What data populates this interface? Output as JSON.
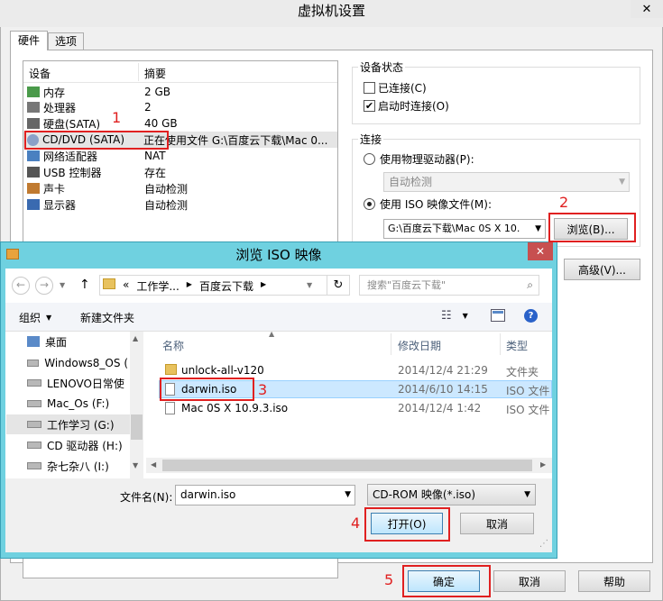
{
  "vm_dialog": {
    "title": "虚拟机设置",
    "close_icon": "close-icon",
    "tabs": [
      "硬件",
      "选项"
    ],
    "device_list": {
      "headers": [
        "设备",
        "摘要"
      ],
      "rows": [
        {
          "icon": "memory-icon",
          "name": "内存",
          "summary": "2 GB"
        },
        {
          "icon": "cpu-icon",
          "name": "处理器",
          "summary": "2"
        },
        {
          "icon": "disk-icon",
          "name": "硬盘(SATA)",
          "summary": "40 GB"
        },
        {
          "icon": "cd-icon",
          "name": "CD/DVD (SATA)",
          "summary": "正在使用文件 G:\\百度云下载\\Mac 0..."
        },
        {
          "icon": "network-icon",
          "name": "网络适配器",
          "summary": "NAT"
        },
        {
          "icon": "usb-icon",
          "name": "USB 控制器",
          "summary": "存在"
        },
        {
          "icon": "sound-icon",
          "name": "声卡",
          "summary": "自动检测"
        },
        {
          "icon": "display-icon",
          "name": "显示器",
          "summary": "自动检测"
        }
      ]
    },
    "device_status": {
      "title": "设备状态",
      "connected": "已连接(C)",
      "connect_on_start": "启动时连接(O)"
    },
    "connection": {
      "title": "连接",
      "physical_drive": "使用物理驱动器(P):",
      "auto_detect": "自动检测",
      "iso_file": "使用 ISO 映像文件(M):",
      "iso_path": "G:\\百度云下载\\Mac 0S X 10.",
      "browse": "浏览(B)..."
    },
    "advanced": "高级(V)...",
    "ok": "确定",
    "cancel": "取消",
    "help": "帮助"
  },
  "iso_dialog": {
    "title": "浏览 ISO 映像",
    "breadcrumb": [
      "«",
      "工作学...",
      "百度云下载"
    ],
    "search_placeholder": "搜索\"百度云下载\"",
    "organize": "组织",
    "new_folder": "新建文件夹",
    "nav": [
      {
        "icon": "folder-icon",
        "label": "桌面"
      },
      {
        "icon": "drive-icon",
        "label": "Windows8_OS ("
      },
      {
        "icon": "drive-icon",
        "label": "LENOVO日常使"
      },
      {
        "icon": "drive-icon",
        "label": "Mac_Os (F:)"
      },
      {
        "icon": "drive-icon",
        "label": "工作学习 (G:)"
      },
      {
        "icon": "cd-drive-icon",
        "label": "CD 驱动器 (H:)"
      },
      {
        "icon": "drive-icon",
        "label": "杂七杂八 (I:)"
      }
    ],
    "columns": [
      "名称",
      "修改日期",
      "类型"
    ],
    "files": [
      {
        "icon": "folder-icon",
        "name": "unlock-all-v120",
        "date": "2014/12/4 21:29",
        "type": "文件夹"
      },
      {
        "icon": "iso-file-icon",
        "name": "darwin.iso",
        "date": "2014/6/10 14:15",
        "type": "ISO 文件"
      },
      {
        "icon": "iso-file-icon",
        "name": "Mac 0S X 10.9.3.iso",
        "date": "2014/12/4 1:42",
        "type": "ISO 文件"
      }
    ],
    "filename_label": "文件名(N):",
    "filename_value": "darwin.iso",
    "filter": "CD-ROM 映像(*.iso)",
    "open": "打开(O)",
    "cancel": "取消"
  },
  "annotations": [
    "1",
    "2",
    "3",
    "4",
    "5"
  ],
  "colors": {
    "accent_red": "#e02020",
    "dialog_frame": "#6fd1e0",
    "selection": "#cce8ff"
  }
}
